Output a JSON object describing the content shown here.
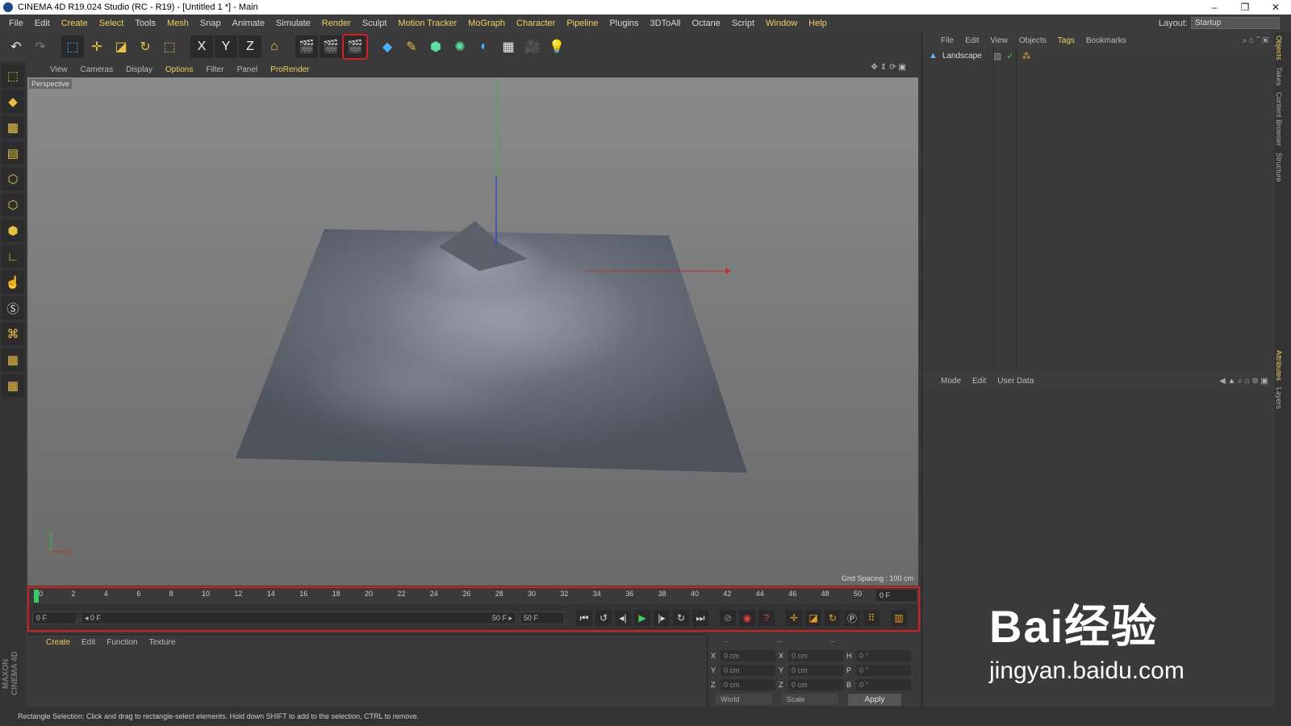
{
  "window": {
    "title": "CINEMA 4D R19.024 Studio (RC - R19) - [Untitled 1 *] - Main",
    "controls": [
      "–",
      "❐",
      "✕"
    ]
  },
  "menubar": {
    "items": [
      "File",
      "Edit",
      "Create",
      "Select",
      "Tools",
      "Mesh",
      "Snap",
      "Animate",
      "Simulate",
      "Render",
      "Sculpt",
      "Motion Tracker",
      "MoGraph",
      "Character",
      "Pipeline",
      "Plugins",
      "3DToAll",
      "Octane",
      "Script",
      "Window",
      "Help"
    ],
    "layout_label": "Layout:",
    "layout_value": "Startup"
  },
  "toolbar": {
    "icons": [
      "undo-icon",
      "redo-icon",
      "live-select-icon",
      "move-icon",
      "scale-icon",
      "rotate-icon",
      "recent-tool-icon",
      "x-axis-icon",
      "y-axis-icon",
      "z-axis-icon",
      "coordinate-system-icon",
      "render-view-icon",
      "render-picture-viewer-icon",
      "edit-render-settings-icon",
      "cube-icon",
      "pen-icon",
      "subdivision-icon",
      "array-icon",
      "deformer-icon",
      "floor-icon",
      "camera-icon",
      "light-icon"
    ],
    "axis_labels": [
      "X",
      "Y",
      "Z"
    ]
  },
  "viewport": {
    "menu": [
      "View",
      "Cameras",
      "Display",
      "Options",
      "Filter",
      "Panel",
      "ProRender"
    ],
    "label": "Perspective",
    "grid_spacing": "Grid Spacing : 100 cm",
    "axis_y": "Y",
    "axis_x": "X"
  },
  "timeline": {
    "ticks": [
      "0",
      "2",
      "4",
      "6",
      "8",
      "10",
      "12",
      "14",
      "16",
      "18",
      "20",
      "22",
      "24",
      "26",
      "28",
      "30",
      "32",
      "34",
      "36",
      "38",
      "40",
      "42",
      "44",
      "46",
      "48",
      "50"
    ],
    "current_frame": "0 F",
    "start_frame": "0 F",
    "slider_start": "◂ 0 F",
    "slider_end": "50 F ▸",
    "end_frame": "50 F",
    "buttons": [
      "⏮",
      "↺",
      "◂|",
      "▶",
      "|▸",
      "↻",
      "⏭"
    ]
  },
  "material_manager": {
    "menu": [
      "Create",
      "Edit",
      "Function",
      "Texture"
    ]
  },
  "coordinates": {
    "headers": [
      "--",
      "--",
      "--"
    ],
    "rows": [
      {
        "a": "X",
        "av": "0 cm",
        "b": "X",
        "bv": "0 cm",
        "c": "H",
        "cv": "0 °"
      },
      {
        "a": "Y",
        "av": "0 cm",
        "b": "Y",
        "bv": "0 cm",
        "c": "P",
        "cv": "0 °"
      },
      {
        "a": "Z",
        "av": "0 cm",
        "b": "Z",
        "bv": "0 cm",
        "c": "B",
        "cv": "0 °"
      }
    ],
    "mode": "World",
    "transform": "Scale",
    "apply": "Apply"
  },
  "object_manager": {
    "menu": [
      "File",
      "Edit",
      "View",
      "Objects",
      "Tags",
      "Bookmarks"
    ],
    "objects": [
      {
        "name": "Landscape"
      }
    ]
  },
  "attribute_manager": {
    "menu": [
      "Mode",
      "Edit",
      "User Data"
    ]
  },
  "side_tabs": [
    "Objects",
    "Takes",
    "Content Browser",
    "Structure",
    "Attributes",
    "Layers"
  ],
  "status": "Rectangle Selection: Click and drag to rectangle-select elements. Hold down SHIFT to add to the selection, CTRL to remove.",
  "watermark": {
    "line1": "Bai经验",
    "line2": "jingyan.baidu.com"
  }
}
